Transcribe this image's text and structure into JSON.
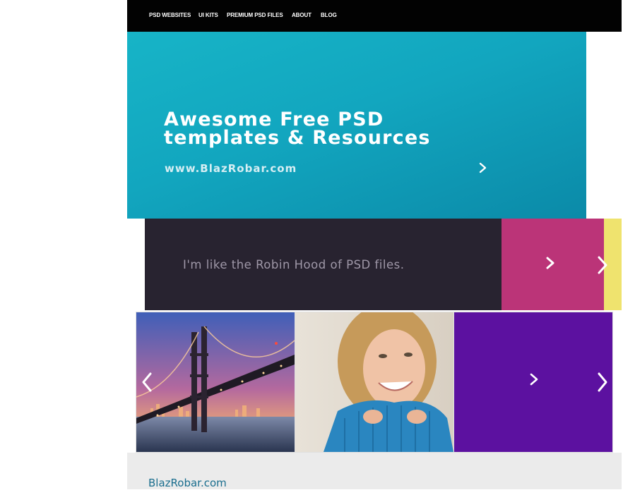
{
  "nav": {
    "items": [
      {
        "label": "PSD WEBSITES"
      },
      {
        "label": "UI KITS"
      },
      {
        "label": "PREMIUM PSD FILES"
      },
      {
        "label": "ABOUT"
      },
      {
        "label": "BLOG"
      }
    ]
  },
  "hero": {
    "title_line1": "Awesome Free PSD",
    "title_line2": "templates & Resources",
    "url": "www.BlazRobar.com",
    "arrow_icon": "chevron-right-icon"
  },
  "quote": {
    "text": "I'm like the Robin Hood of PSD files."
  },
  "gallery": {
    "photos": [
      {
        "name": "bridge-photo"
      },
      {
        "name": "woman-photo"
      }
    ]
  },
  "footer": {
    "brand": "BlazRobar.com"
  },
  "colors": {
    "nav_bg": "#020202",
    "hero_accent": "#12a6bf",
    "quote_bg": "#282330",
    "pink": "#bb3478",
    "yellow": "#efe36e",
    "purple": "#5c11a0",
    "footer_bg": "#ebebeb",
    "footer_link": "#1a6e8e"
  }
}
